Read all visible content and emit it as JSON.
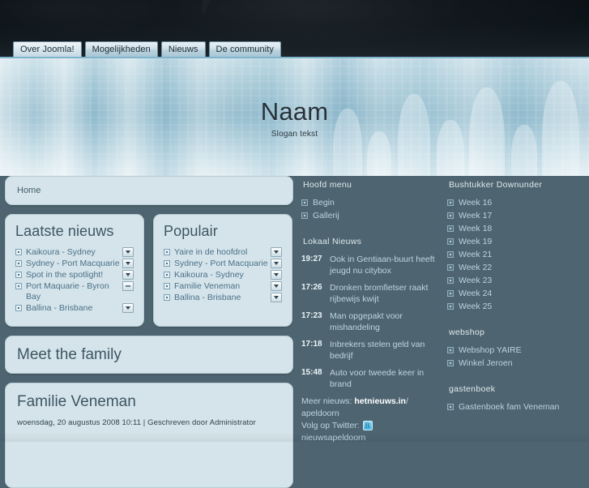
{
  "nav": {
    "tabs": [
      {
        "label": "Over Joomla!",
        "active": true
      },
      {
        "label": "Mogelijkheden",
        "active": false
      },
      {
        "label": "Nieuws",
        "active": false
      },
      {
        "label": "De community",
        "active": false
      }
    ]
  },
  "banner": {
    "title": "Naam",
    "slogan": "Slogan tekst"
  },
  "breadcrumb": {
    "label": "Home"
  },
  "left": {
    "latest": {
      "title": "Laatste nieuws",
      "items": [
        {
          "label": "Kaikoura - Sydney",
          "control": "dropdown"
        },
        {
          "label": "Sydney - Port Macquarie",
          "control": "dropdown"
        },
        {
          "label": "Spot in the spotlight!",
          "control": "dropdown"
        },
        {
          "label": "Port Maquarie - Byron Bay",
          "control": "flat"
        },
        {
          "label": "Ballina - Brisbane",
          "control": "dropdown"
        }
      ]
    },
    "popular": {
      "title": "Populair",
      "items": [
        {
          "label": "Yaire in de hoofdrol",
          "control": "dropdown"
        },
        {
          "label": "Sydney - Port Macquarie",
          "control": "dropdown"
        },
        {
          "label": "Kaikoura - Sydney",
          "control": "dropdown"
        },
        {
          "label": "Familie Veneman",
          "control": "dropdown"
        },
        {
          "label": "Ballina - Brisbane",
          "control": "dropdown"
        }
      ]
    },
    "meet_the_family": "Meet the family",
    "article": {
      "title": "Familie Veneman",
      "meta": "woensdag, 20 augustus 2008 10:11 | Geschreven door Administrator"
    }
  },
  "middle": {
    "main_menu": {
      "title": "Hoofd menu",
      "items": [
        "Begin",
        "Gallerij"
      ]
    },
    "local_news": {
      "title": "Lokaal Nieuws",
      "items": [
        {
          "time": "19:27",
          "text": "Ook in Gentiaan-buurt heeft jeugd nu citybox"
        },
        {
          "time": "17:26",
          "text": "Dronken bromfietser raakt rijbewijs kwijt"
        },
        {
          "time": "17:23",
          "text": "Man opgepakt voor mishandeling"
        },
        {
          "time": "17:18",
          "text": "Inbrekers stelen geld van bedrijf"
        },
        {
          "time": "15:48",
          "text": "Auto voor tweede keer in brand"
        }
      ],
      "more_label": "Meer nieuws: ",
      "more_link": "hetnieuws.in",
      "more_suffix": "/ apeldoorn",
      "twitter_label": "Volg op Twitter: ",
      "twitter_handle": "nieuwsapeldoorn"
    }
  },
  "right": {
    "bushtukker": {
      "title": "Bushtukker Downunder",
      "items": [
        "Week 16",
        "Week 17",
        "Week 18",
        "Week 19",
        "Week 21",
        "Week 22",
        "Week 23",
        "Week 24",
        "Week 25"
      ]
    },
    "webshop": {
      "title": "webshop",
      "items": [
        "Webshop YAIRE",
        "Winkel Jeroen"
      ]
    },
    "gastenboek": {
      "title": "gastenboek",
      "items": [
        "Gastenboek fam Veneman"
      ]
    }
  },
  "colors": {
    "page_background": "#4e6571",
    "panel_background": "#d5e4ea",
    "topbar": "#0d1419",
    "banner_accent": "#7fb4cd",
    "link_text": "#4a7089",
    "heading_text": "#3d5664"
  }
}
